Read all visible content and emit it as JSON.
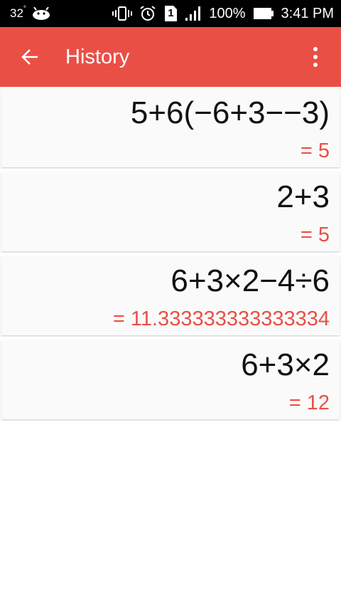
{
  "status_bar": {
    "temperature": "32",
    "degree": "°",
    "sim_label": "1",
    "battery_percent": "100%",
    "time": "3:41 PM"
  },
  "app_bar": {
    "title": "History"
  },
  "history": [
    {
      "expression": "5+6(−6+3−−3)",
      "result": "= 5"
    },
    {
      "expression": "2+3",
      "result": "= 5"
    },
    {
      "expression": "6+3×2−4÷6",
      "result": "= 11.333333333333334"
    },
    {
      "expression": "6+3×2",
      "result": "= 12"
    }
  ],
  "colors": {
    "accent": "#ea4f46",
    "card_bg": "#fafafa",
    "status_bar": "#000000"
  },
  "icons": [
    "android-icon",
    "vibrate-icon",
    "alarm-icon",
    "sim-icon",
    "signal-icon",
    "battery-icon",
    "back-arrow-icon",
    "more-vert-icon"
  ]
}
